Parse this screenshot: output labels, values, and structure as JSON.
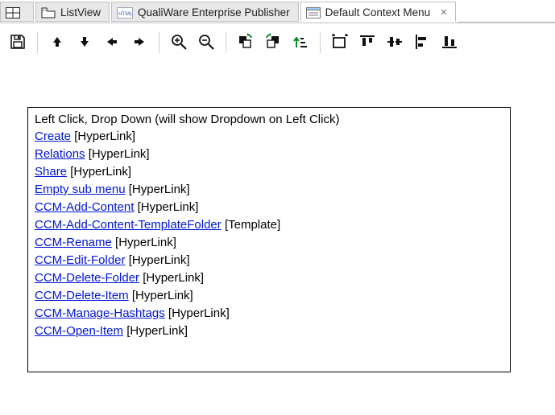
{
  "tabs": {
    "t0": {
      "label": ""
    },
    "t1": {
      "label": "ListView"
    },
    "t2": {
      "label": "QualiWare Enterprise Publisher"
    },
    "t3": {
      "label": "Default Context Menu"
    }
  },
  "content": {
    "heading": "Left Click, Drop Down (will show Dropdown on Left Click)",
    "items": [
      {
        "name": "Create",
        "type": "[HyperLink]"
      },
      {
        "name": "Relations",
        "type": "[HyperLink]"
      },
      {
        "name": "Share",
        "type": "[HyperLink]"
      },
      {
        "name": "Empty sub menu",
        "type": "[HyperLink]"
      },
      {
        "name": "CCM-Add-Content",
        "type": "[HyperLink]"
      },
      {
        "name": "CCM-Add-Content-TemplateFolder",
        "type": "[Template]"
      },
      {
        "name": "CCM-Rename",
        "type": "[HyperLink]"
      },
      {
        "name": "CCM-Edit-Folder",
        "type": "[HyperLink]"
      },
      {
        "name": "CCM-Delete-Folder",
        "type": "[HyperLink]"
      },
      {
        "name": "CCM-Delete-Item",
        "type": "[HyperLink]"
      },
      {
        "name": "CCM-Manage-Hashtags",
        "type": "[HyperLink]"
      },
      {
        "name": "CCM-Open-Item",
        "type": "[HyperLink]"
      }
    ]
  }
}
